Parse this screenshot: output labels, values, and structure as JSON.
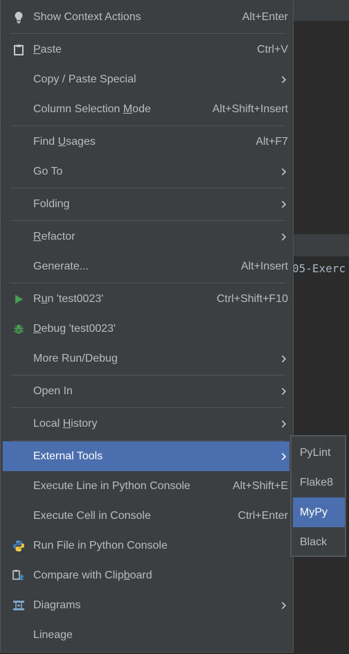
{
  "background": {
    "console_text": "05-Exerc"
  },
  "menu": {
    "show_context_actions": {
      "label": "Show Context Actions",
      "shortcut": "Alt+Enter",
      "icon": "lightbulb-icon"
    },
    "paste": {
      "label_u": "P",
      "label_rest": "aste",
      "shortcut": "Ctrl+V",
      "icon": "clipboard-icon"
    },
    "copy_paste_special": {
      "label": "Copy / Paste Special"
    },
    "column_selection_mode": {
      "label_pre": "Column Selection ",
      "label_u": "M",
      "label_rest": "ode",
      "shortcut": "Alt+Shift+Insert"
    },
    "find_usages": {
      "label_pre": "Find ",
      "label_u": "U",
      "label_rest": "sages",
      "shortcut": "Alt+F7"
    },
    "go_to": {
      "label": "Go To"
    },
    "folding": {
      "label": "Folding"
    },
    "refactor": {
      "label_u": "R",
      "label_rest": "efactor"
    },
    "generate": {
      "label": "Generate...",
      "shortcut": "Alt+Insert"
    },
    "run": {
      "label_pre": "R",
      "label_u": "u",
      "label_rest": "n 'test0023'",
      "shortcut": "Ctrl+Shift+F10",
      "icon": "run-icon"
    },
    "debug": {
      "label_u": "D",
      "label_rest": "ebug 'test0023'",
      "icon": "bug-icon"
    },
    "more_run_debug": {
      "label": "More Run/Debug"
    },
    "open_in": {
      "label": "Open In"
    },
    "local_history": {
      "label_pre": "Local ",
      "label_u": "H",
      "label_rest": "istory"
    },
    "external_tools": {
      "label": "External Tools"
    },
    "execute_line": {
      "label": "Execute Line in Python Console",
      "shortcut": "Alt+Shift+E"
    },
    "execute_cell": {
      "label": "Execute Cell in Console",
      "shortcut": "Ctrl+Enter"
    },
    "run_file": {
      "label": "Run File in Python Console",
      "icon": "python-icon"
    },
    "compare": {
      "label_pre": "Compare with Clip",
      "label_u": "b",
      "label_rest": "oard",
      "icon": "compare-icon"
    },
    "diagrams": {
      "label": "Diagrams",
      "icon": "diagram-icon"
    },
    "lineage": {
      "label": "Lineage"
    }
  },
  "submenu": {
    "items": [
      "PyLint",
      "Flake8",
      "MyPy",
      "Black"
    ],
    "selected": "MyPy"
  },
  "colors": {
    "menu_bg": "#3c3f41",
    "selection": "#4b6eaf",
    "run_green": "#499c54",
    "separator": "#555555"
  }
}
